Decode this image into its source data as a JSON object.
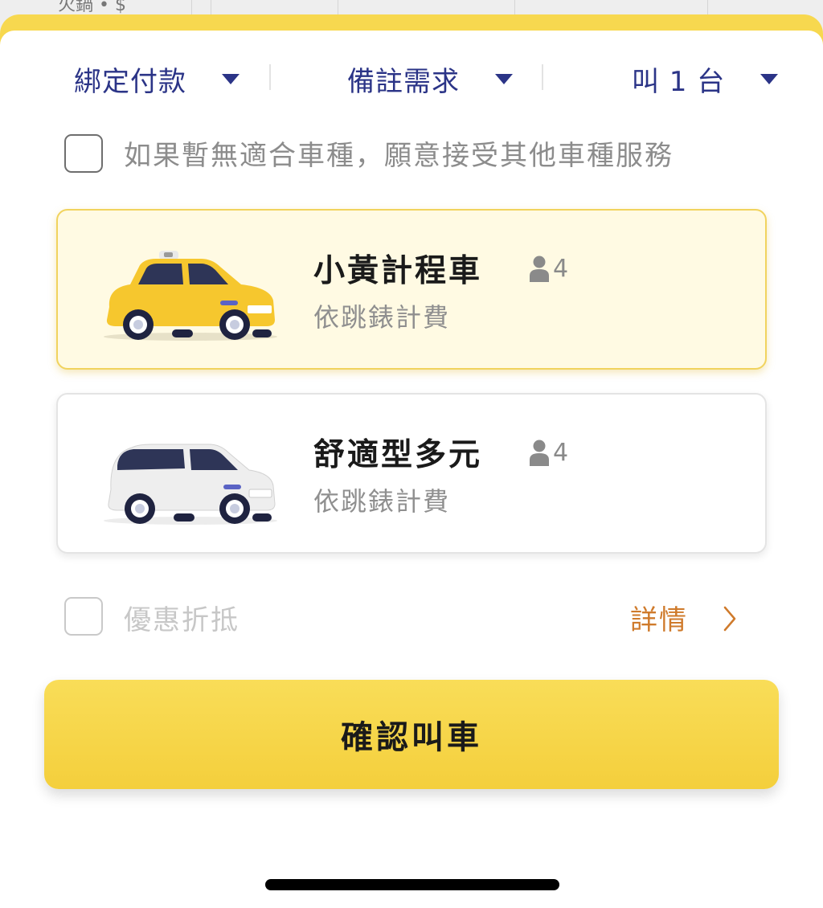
{
  "map": {
    "partial_label": "火鍋 • $"
  },
  "options": {
    "payment_label": "綁定付款",
    "remark_label": "備註需求",
    "count_label": "叫 1 台"
  },
  "accept_other": {
    "label": "如果暫無適合車種，願意接受其他車種服務",
    "checked": false
  },
  "vehicles": [
    {
      "name": "小黃計程車",
      "capacity": "4",
      "fare": "依跳錶計費",
      "selected": true,
      "icon": "taxi-car-icon",
      "body_color": "#f6c72e"
    },
    {
      "name": "舒適型多元",
      "capacity": "4",
      "fare": "依跳錶計費",
      "selected": false,
      "icon": "mpv-car-icon",
      "body_color": "#eeeeee"
    }
  ],
  "discount": {
    "label": "優惠折抵",
    "checked": false,
    "details_label": "詳情"
  },
  "confirm": {
    "label": "確認叫車"
  },
  "colors": {
    "accent": "#f7d84f",
    "selected_border": "#f1d35e",
    "option_text": "#2b3487",
    "details_link": "#cf7a2b"
  },
  "icons": {
    "caret": "caret-down-icon",
    "person": "person-icon",
    "chevron": "chevron-right-icon"
  }
}
